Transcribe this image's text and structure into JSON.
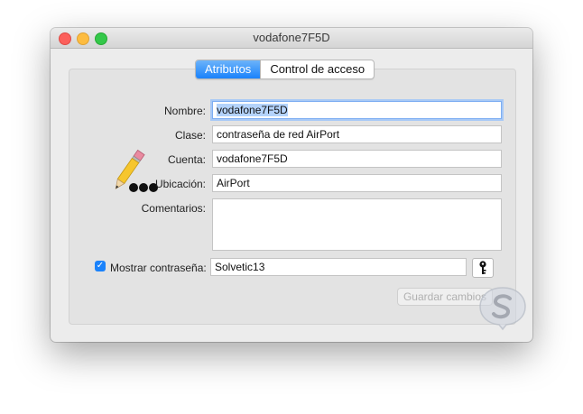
{
  "window": {
    "title": "vodafone7F5D"
  },
  "tabs": [
    {
      "label": "Atributos",
      "active": true
    },
    {
      "label": "Control de acceso",
      "active": false
    }
  ],
  "form": {
    "name_label": "Nombre:",
    "name_value": "vodafone7F5D",
    "kind_label": "Clase:",
    "kind_value": "contraseña de red AirPort",
    "account_label": "Cuenta:",
    "account_value": "vodafone7F5D",
    "location_label": "Ubicación:",
    "location_value": "AirPort",
    "comments_label": "Comentarios:",
    "comments_value": "",
    "show_password_label": "Mostrar contraseña:",
    "show_password_checked": true,
    "password_value": "Solvetic13"
  },
  "buttons": {
    "save_label": "Guardar cambios"
  },
  "icons": {
    "app_icon": "pencil-dots-icon",
    "key": "key-icon",
    "watermark": "solvetic-logo-icon"
  },
  "colors": {
    "accent": "#1a82fb",
    "close": "#fc605c",
    "minimize": "#fdbc40",
    "maximize": "#34c84a"
  }
}
